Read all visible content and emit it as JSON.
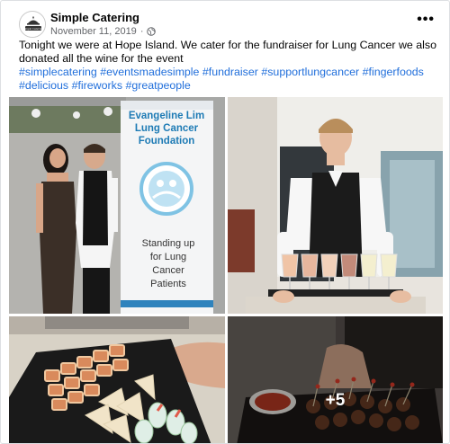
{
  "post": {
    "page_name": "Simple Catering",
    "date": "November 11, 2019",
    "separator": "·",
    "privacy_icon": "globe-icon",
    "more_icon": "ellipsis-icon",
    "more_glyph": "•••",
    "avatar_logo_text": "Simple Catering",
    "body_text": "Tonight we were at Hope Island. We cater for the fundraiser for Lung Cancer we also donated all the wine for the event",
    "hashtags": [
      "#simplecatering",
      "#eventsmadesimple",
      "#fundraiser",
      "#supportlungcancer",
      "#fingerfoods",
      "#delicious",
      "#fireworks",
      "#greatpeople"
    ]
  },
  "photos": {
    "banner": {
      "title_line1": "Evangeline Lim",
      "title_line2": "Lung Cancer",
      "title_line3": "Foundation",
      "tagline_line1": "Standing up",
      "tagline_line2": "for Lung",
      "tagline_line3": "Cancer",
      "tagline_line4": "Patients"
    },
    "more_count": "+5"
  },
  "colors": {
    "link": "#216fdb",
    "meta": "#65676b",
    "banner_title": "#1e7bb5"
  }
}
